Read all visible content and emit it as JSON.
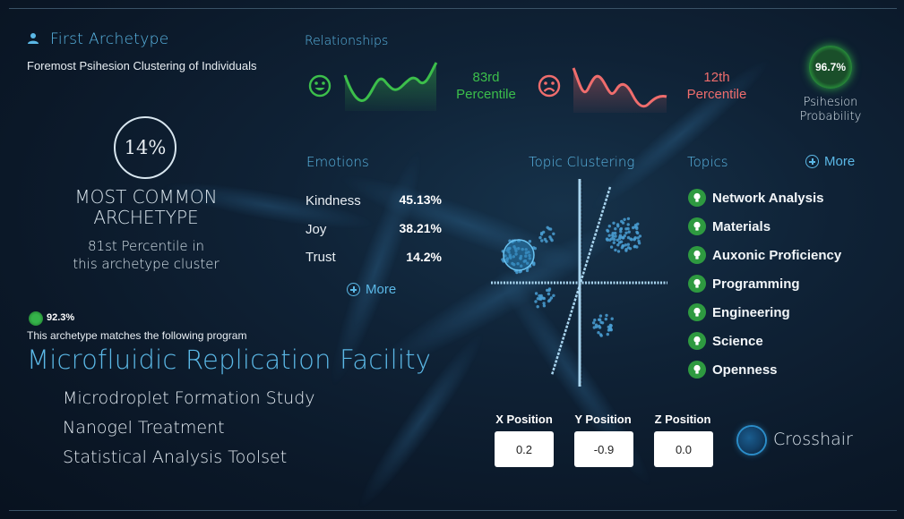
{
  "archetype": {
    "title": "First Archetype",
    "subtitle": "Foremost Psihesion Clustering of Individuals",
    "percent": "14%",
    "most_common": "MOST COMMON ARCHETYPE",
    "percentile_line1": "81st Percentile in",
    "percentile_line2": "this archetype cluster",
    "match_percent": "92.3%",
    "match_text": "This archetype matches the following program",
    "program": "Microfluidic Replication Facility",
    "program_items": [
      "Microdroplet Formation Study",
      "Nanogel Treatment",
      "Statistical Analysis Toolset"
    ]
  },
  "relationships": {
    "title": "Relationships",
    "positive": {
      "percentile": "83rd",
      "label": "Percentile",
      "icon": "smile-face-icon",
      "color": "#3cbf4b"
    },
    "negative": {
      "percentile": "12th",
      "label": "Percentile",
      "icon": "sad-face-icon",
      "color": "#ef6d6d"
    },
    "probability": {
      "value": "96.7%",
      "label_line1": "Psihesion",
      "label_line2": "Probability"
    }
  },
  "emotions": {
    "title": "Emotions",
    "items": [
      {
        "name": "Kindness",
        "value": "45.13%"
      },
      {
        "name": "Joy",
        "value": "38.21%"
      },
      {
        "name": "Trust",
        "value": "14.2%"
      }
    ],
    "more": "More"
  },
  "topic_clustering": {
    "title": "Topic Clustering"
  },
  "topics": {
    "title": "Topics",
    "more": "More",
    "items": [
      "Network Analysis",
      "Materials",
      "Auxonic Proficiency",
      "Programming",
      "Engineering",
      "Science",
      "Openness"
    ]
  },
  "positions": {
    "x": {
      "label": "X Position",
      "value": "0.2"
    },
    "y": {
      "label": "Y Position",
      "value": "-0.9"
    },
    "z": {
      "label": "Z Position",
      "value": "0.0"
    }
  },
  "crosshair": {
    "label": "Crosshair"
  }
}
